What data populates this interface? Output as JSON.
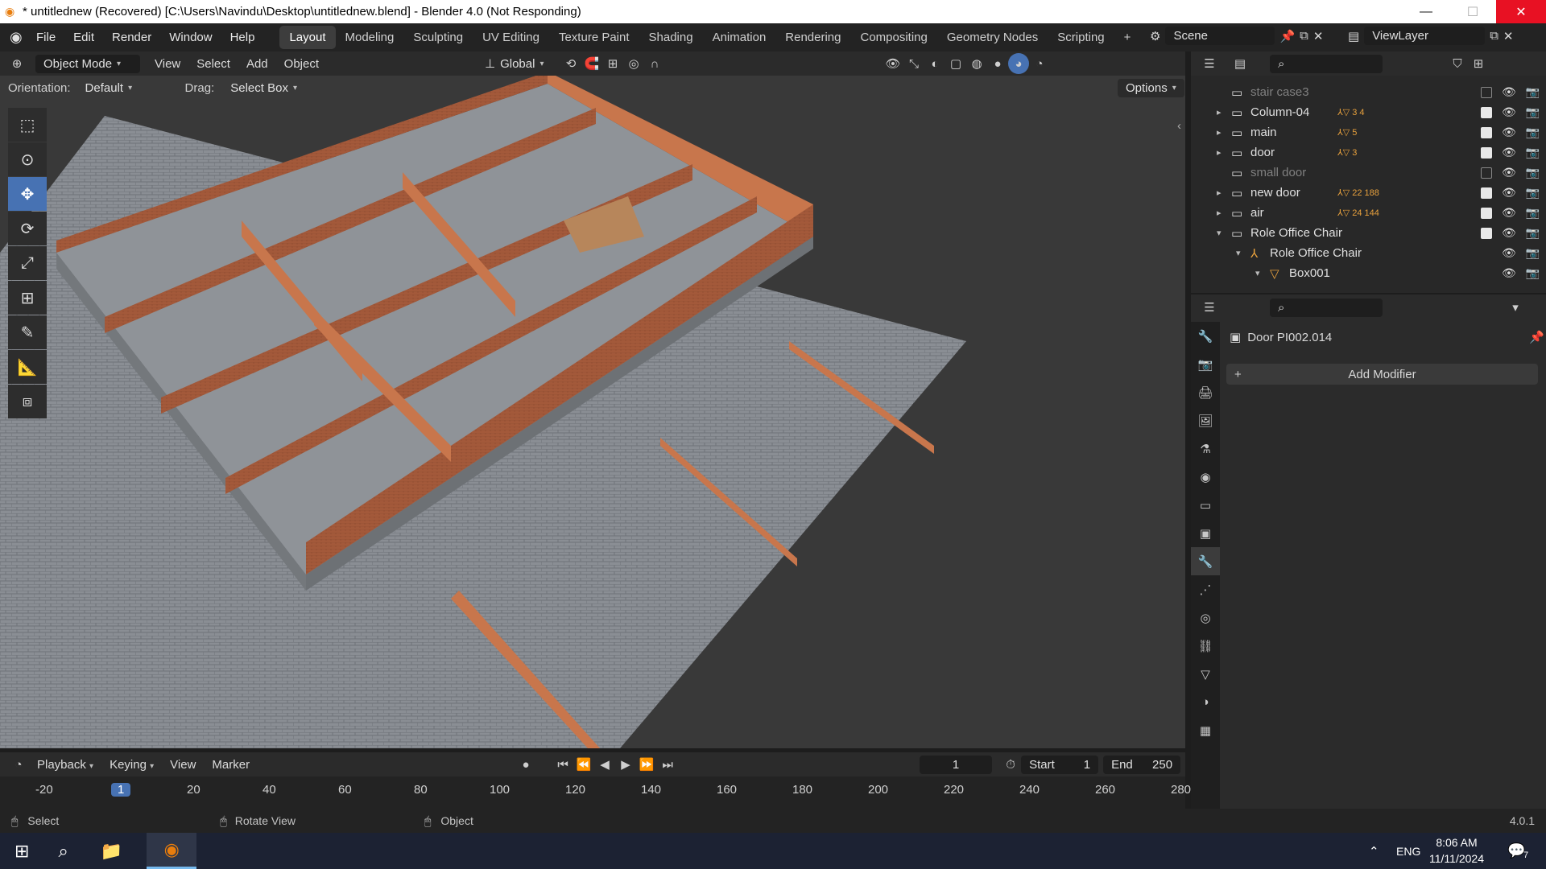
{
  "window": {
    "title": "* untitlednew (Recovered) [C:\\Users\\Navindu\\Desktop\\untitlednew.blend] - Blender 4.0 (Not Responding)"
  },
  "menu": [
    "File",
    "Edit",
    "Render",
    "Window",
    "Help"
  ],
  "workspaces": [
    "Layout",
    "Modeling",
    "Sculpting",
    "UV Editing",
    "Texture Paint",
    "Shading",
    "Animation",
    "Rendering",
    "Compositing",
    "Geometry Nodes",
    "Scripting"
  ],
  "scene": {
    "label": "Scene",
    "view_layer": "ViewLayer"
  },
  "viewport_header": {
    "mode": "Object Mode",
    "view": "View",
    "select": "Select",
    "add": "Add",
    "object": "Object",
    "transform_orientation": "Global",
    "options": "Options"
  },
  "tool_settings": {
    "orientation_label": "Orientation:",
    "orientation_value": "Default",
    "drag_label": "Drag:",
    "drag_value": "Select Box"
  },
  "outliner": {
    "rows": [
      {
        "name": "stair case3",
        "indent": 0,
        "expand": "",
        "visible": false,
        "dim": true
      },
      {
        "name": "Column-04",
        "indent": 0,
        "expand": "▸",
        "visible": true,
        "badges": "3 4"
      },
      {
        "name": "main",
        "indent": 0,
        "expand": "▸",
        "visible": true,
        "badges": "5"
      },
      {
        "name": "door",
        "indent": 0,
        "expand": "▸",
        "visible": true,
        "badges": "3"
      },
      {
        "name": "small door",
        "indent": 0,
        "expand": "",
        "visible": false,
        "dim": true
      },
      {
        "name": "new door",
        "indent": 0,
        "expand": "▸",
        "visible": true,
        "badges": "22 188"
      },
      {
        "name": "air",
        "indent": 0,
        "expand": "▸",
        "visible": true,
        "badges": "24 144"
      },
      {
        "name": "Role Office Chair",
        "indent": 0,
        "expand": "▾",
        "visible": true
      },
      {
        "name": "Role Office Chair",
        "indent": 1,
        "expand": "▾",
        "visible": true
      },
      {
        "name": "Box001",
        "indent": 2,
        "expand": "▾",
        "visible": true
      }
    ]
  },
  "properties": {
    "object_name": "Door PI002.014",
    "add_modifier": "Add Modifier"
  },
  "timeline": {
    "playback": "Playback",
    "keying": "Keying",
    "view": "View",
    "marker": "Marker",
    "current_frame": "1",
    "start_label": "Start",
    "start_value": "1",
    "end_label": "End",
    "end_value": "250",
    "ruler": [
      "-20",
      "1",
      "20",
      "40",
      "60",
      "80",
      "100",
      "120",
      "140",
      "160",
      "180",
      "200",
      "220",
      "240",
      "260",
      "280"
    ]
  },
  "statusbar": {
    "select": "Select",
    "rotate": "Rotate View",
    "object": "Object",
    "version": "4.0.1"
  },
  "taskbar": {
    "lang": "ENG",
    "time": "8:06 AM",
    "date": "11/11/2024",
    "notif": "7"
  },
  "colors": {
    "accent": "#4772b3",
    "wall": "#b8653d",
    "floor": "#8e9296"
  }
}
